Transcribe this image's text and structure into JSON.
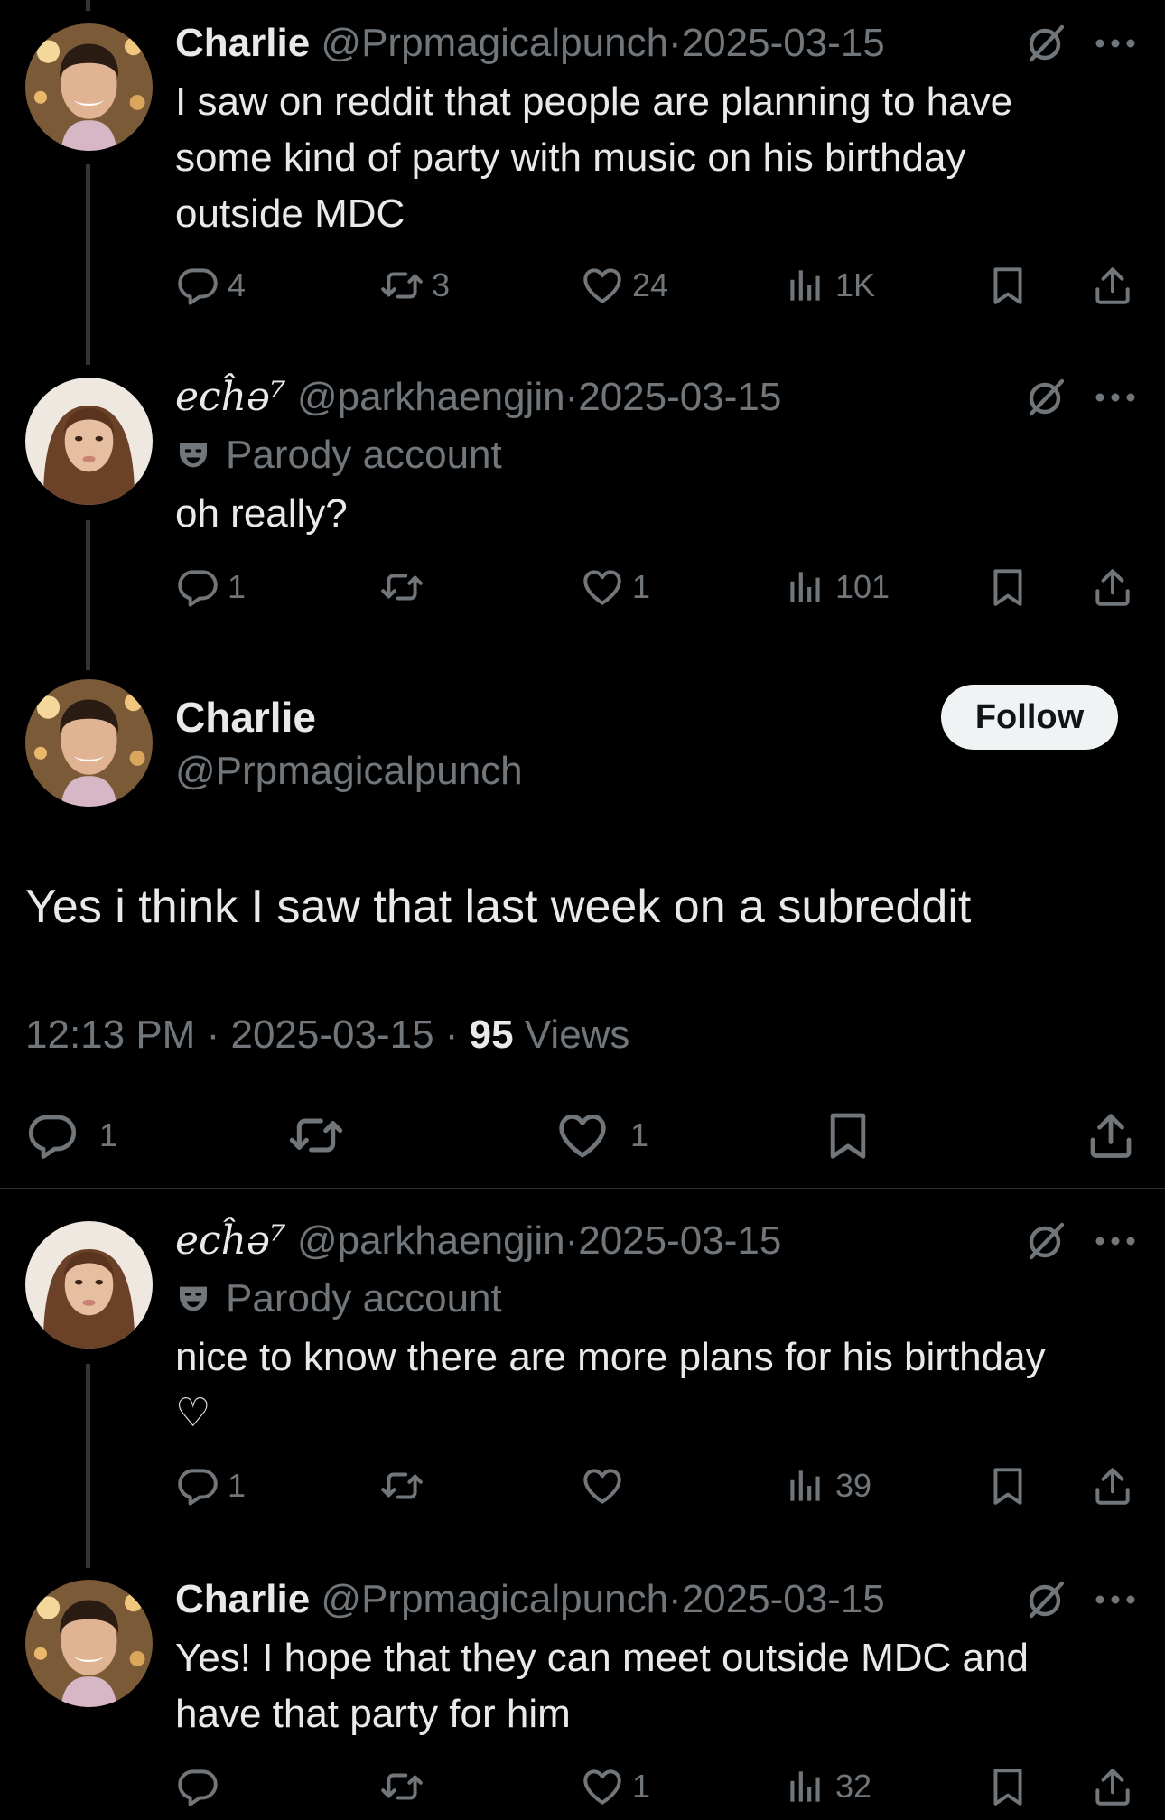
{
  "posts": [
    {
      "name": "Charlie",
      "handle": "@Prpmagicalpunch",
      "sep": "·",
      "date": "2025-03-15",
      "text_lines": [
        "I saw on reddit that people are planning to have",
        "some kind of party with music on his birthday",
        "outside MDC"
      ],
      "replies": "4",
      "reposts": "3",
      "likes": "24",
      "views": "1K"
    },
    {
      "name": "ecĥǝ⁷",
      "handle": "@parkhaengjin",
      "sep": "·",
      "date": "2025-03-15",
      "label": "Parody account",
      "text_lines": [
        "oh really?"
      ],
      "replies": "1",
      "reposts": "",
      "likes": "1",
      "views": "101"
    }
  ],
  "main": {
    "name": "Charlie",
    "handle": "@Prpmagicalpunch",
    "follow_label": "Follow",
    "text": "Yes i think I saw that last week on a subreddit",
    "time": "12:13 PM",
    "sep": "·",
    "date": "2025-03-15",
    "views_count": "95",
    "views_label": "Views",
    "replies": "1",
    "likes": "1"
  },
  "replies": [
    {
      "name": "ecĥǝ⁷",
      "handle": "@parkhaengjin",
      "sep": "·",
      "date": "2025-03-15",
      "label": "Parody account",
      "text_lines": [
        "nice to know there are more plans for his birthday",
        "♡"
      ],
      "replies": "1",
      "reposts": "",
      "likes": "",
      "views": "39"
    },
    {
      "name": "Charlie",
      "handle": "@Prpmagicalpunch",
      "sep": "·",
      "date": "2025-03-15",
      "text_lines": [
        "Yes! I hope that they can meet outside MDC and",
        "have that party for him"
      ],
      "replies": "",
      "reposts": "",
      "likes": "1",
      "views": "32"
    }
  ],
  "icons": {
    "reply": "reply-icon",
    "repost": "repost-icon",
    "like": "heart-icon",
    "views": "views-icon",
    "bookmark": "bookmark-icon",
    "share": "share-icon",
    "grok": "grok-icon",
    "more": "more-icon",
    "parody": "parody-mask-icon"
  },
  "colors": {
    "background": "#000000",
    "text": "#e7e9ea",
    "muted": "#71767b",
    "follow_bg": "#eff3f4"
  }
}
